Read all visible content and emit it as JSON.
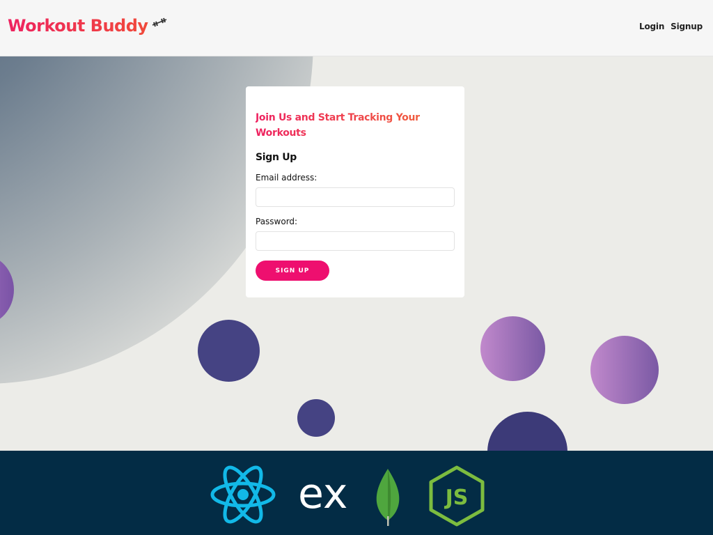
{
  "header": {
    "brand": "Workout Buddy",
    "brand_icon": "dumbbell-icon",
    "nav": [
      {
        "label": "Login"
      },
      {
        "label": "Signup"
      }
    ]
  },
  "signup_form": {
    "heading": "Join Us and Start Tracking Your Workouts",
    "title": "Sign Up",
    "email_label": "Email address:",
    "email_value": "",
    "password_label": "Password:",
    "password_value": "",
    "submit_label": "SIGN UP"
  },
  "footer": {
    "logos": [
      "react-logo",
      "express-logo",
      "mongodb-logo",
      "nodejs-logo"
    ],
    "express_text": "ex",
    "node_text": "JS"
  },
  "colors": {
    "brand_gradient_start": "#ee2360",
    "brand_gradient_end": "#f04a3a",
    "button": "#ee0f6f",
    "footer_bg": "#032c45",
    "bubble_indigo": "#454383",
    "bubble_purple": "#a070b8"
  }
}
